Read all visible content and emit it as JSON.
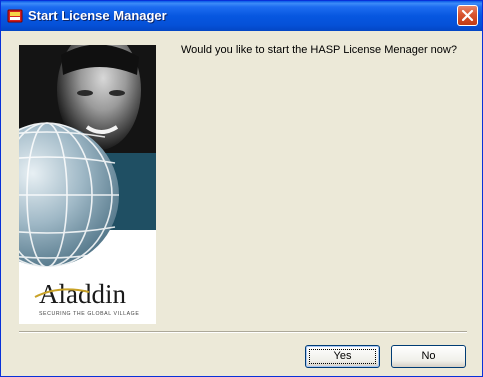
{
  "window": {
    "title": "Start License Manager",
    "app_icon": "hasp-key-icon",
    "close_icon": "close-icon"
  },
  "side_image": {
    "brand": "Aladdin",
    "tagline": "SECURING THE GLOBAL VILLAGE"
  },
  "dialog": {
    "question": "Would you like to start the HASP License Menager now?"
  },
  "buttons": {
    "yes_label": "Yes",
    "no_label": "No"
  },
  "colors": {
    "title_bar": "#0757e0",
    "close_button": "#d8542f",
    "dialog_background": "#ece9d8",
    "image_teal": "#1f4f63"
  }
}
